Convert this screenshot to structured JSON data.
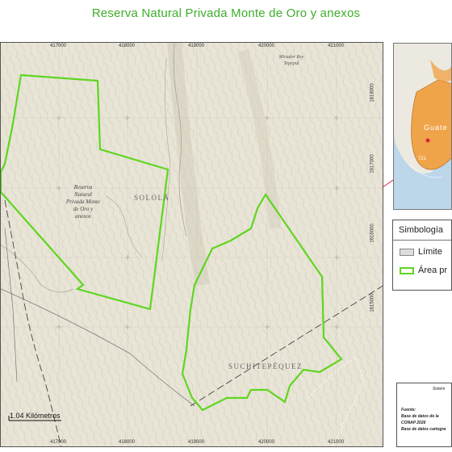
{
  "title": "Reserva Natural Privada Monte de Oro y anexos",
  "map": {
    "x_ticks": [
      "417000",
      "418000",
      "419000",
      "420000",
      "421000"
    ],
    "y_ticks": [
      "1618000",
      "1617000",
      "1616000",
      "1615000"
    ],
    "labels": {
      "reserve": [
        "Reserva",
        "Natural",
        "Privada Monte",
        "de Oro y",
        "anexos"
      ],
      "solola": "SOLOLÁ",
      "suchitepequez": "SUCHITEPÉQUEZ",
      "mirador": [
        "Mirador Rey",
        "Tepepul"
      ]
    },
    "scale_label": "1.04 Kilómetros",
    "colors": {
      "protected_area": "#5fd620",
      "terrain": "#e8e4d6",
      "road": "#555555"
    }
  },
  "inset": {
    "country_label": "Guate",
    "number_label": "721",
    "colors": {
      "ocean": "#bcd6ea",
      "country": "#f0a44a",
      "marker_line": "#d6273a"
    }
  },
  "legend": {
    "title": "Simbología",
    "items": [
      {
        "label": "Límite",
        "swatch": "#dddddd"
      },
      {
        "label": "Área pr",
        "swatch": "#5fd620"
      }
    ]
  },
  "info": {
    "title": "Sistem",
    "lines": [
      "Fuente:",
      "Base de datos de la",
      "CONAP 2026",
      "Base de datos cartogra"
    ]
  }
}
